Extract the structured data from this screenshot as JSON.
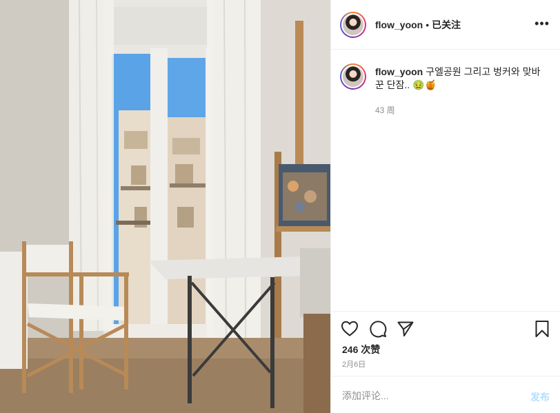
{
  "post": {
    "author": "flow_yoon",
    "follow_separator": "•",
    "follow_status": "已关注",
    "more_label": "•••",
    "caption": "구엘공원 그리고 벙커와 맞바꾼 단잠.. 🤢🍯",
    "caption_time": "43 周",
    "likes": "246 次赞",
    "date": "2月6日"
  },
  "actions": {
    "like_icon": "heart-icon",
    "comment_icon": "comment-bubble-icon",
    "share_icon": "paper-plane-icon",
    "save_icon": "bookmark-icon"
  },
  "comment_box": {
    "placeholder": "添加评论...",
    "post_label": "发布"
  },
  "colors": {
    "primary_text": "#262626",
    "secondary_text": "#8e8e8e",
    "post_button_disabled": "#b2dffc",
    "divider": "#efefef"
  }
}
